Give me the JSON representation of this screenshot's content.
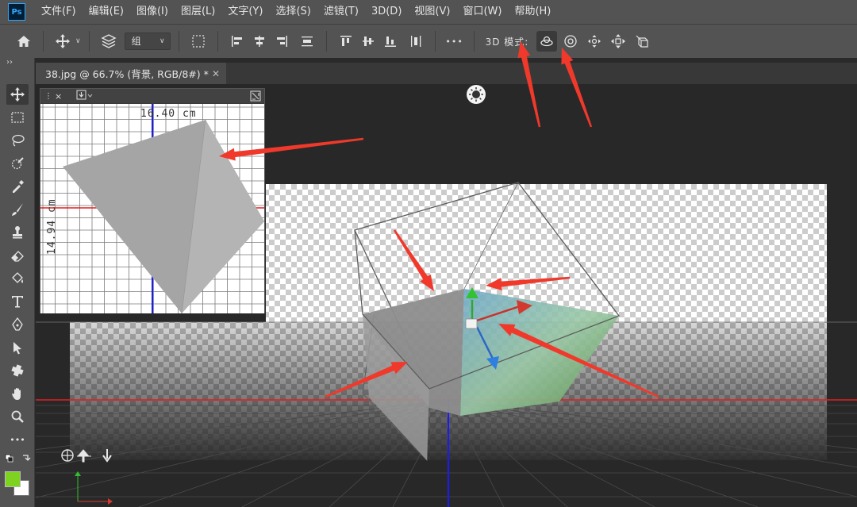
{
  "app": {
    "logo": "Ps"
  },
  "menu": [
    "文件(F)",
    "编辑(E)",
    "图像(I)",
    "图层(L)",
    "文字(Y)",
    "选择(S)",
    "滤镜(T)",
    "3D(D)",
    "视图(V)",
    "窗口(W)",
    "帮助(H)"
  ],
  "options": {
    "group_select": "组",
    "mode_label": "3D 模式:",
    "more": "•••"
  },
  "toolbar": {
    "collapse": "››"
  },
  "document": {
    "tab_title": "38.jpg @ 66.7% (背景, RGB/8#) *",
    "close_glyph": "✕"
  },
  "secondary_view": {
    "width_label": "16.40 cm",
    "height_label": "14.94 cm",
    "close_glyph": "×"
  },
  "colors": {
    "foreground": "#7ed321",
    "background": "#ffffff",
    "annotation_arrow": "#f0392b",
    "ground_red": "#e0201e",
    "ground_blue": "#1a1aff"
  }
}
